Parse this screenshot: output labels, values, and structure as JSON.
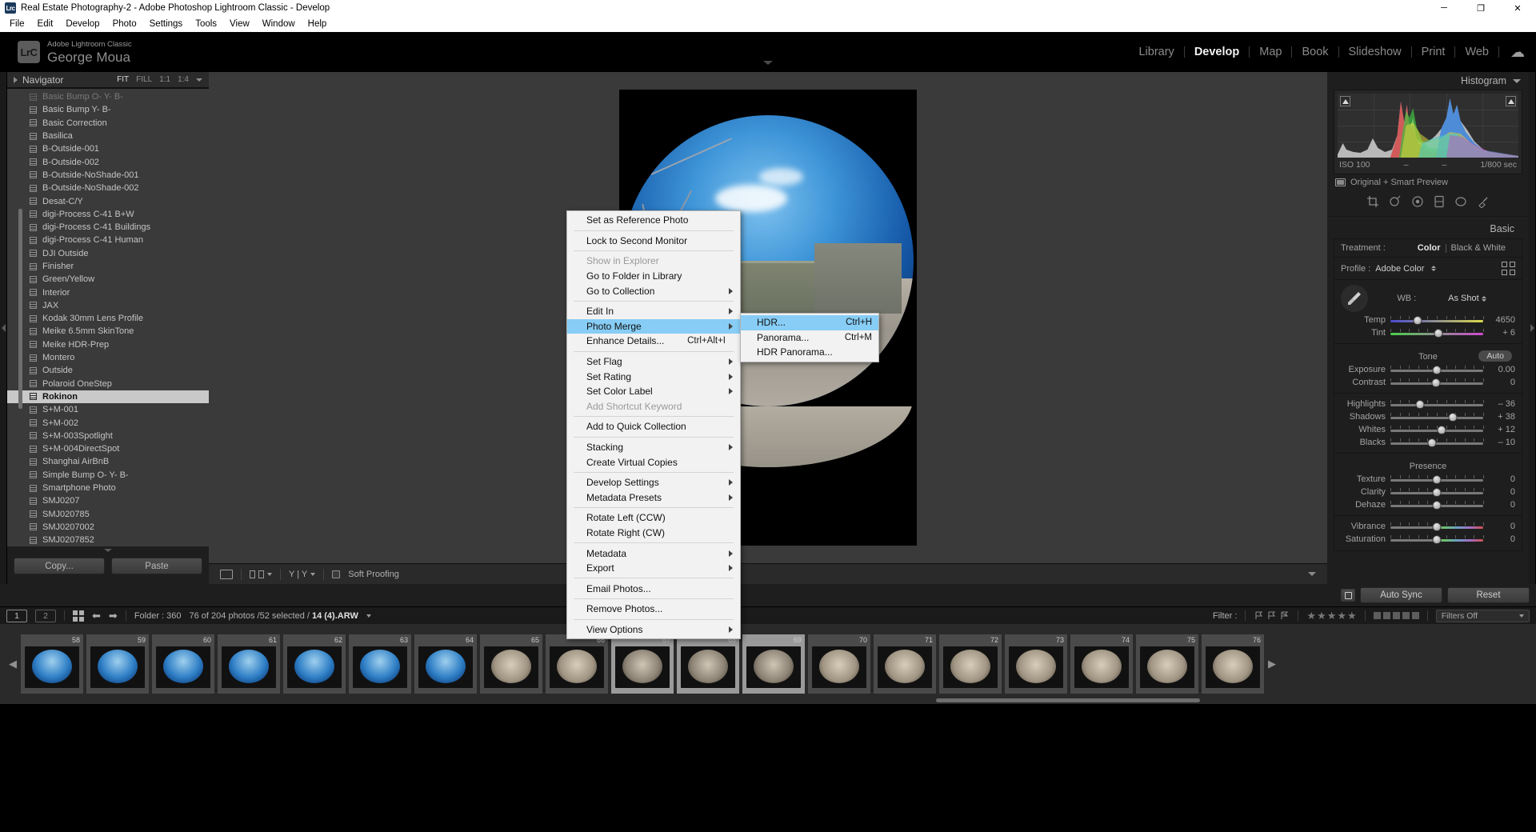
{
  "window": {
    "title": "Real Estate Photography-2 - Adobe Photoshop Lightroom Classic - Develop",
    "app_abbrev": "Lrc",
    "minimize": "─",
    "maximize": "❐",
    "close": "✕"
  },
  "menubar": [
    "File",
    "Edit",
    "Develop",
    "Photo",
    "Settings",
    "Tools",
    "View",
    "Window",
    "Help"
  ],
  "identity": {
    "badge": "LrC",
    "app_name": "Adobe Lightroom Classic",
    "user": "George Moua"
  },
  "modules": [
    {
      "label": "Library",
      "active": false
    },
    {
      "label": "Develop",
      "active": true
    },
    {
      "label": "Map",
      "active": false
    },
    {
      "label": "Book",
      "active": false
    },
    {
      "label": "Slideshow",
      "active": false
    },
    {
      "label": "Print",
      "active": false
    },
    {
      "label": "Web",
      "active": false
    }
  ],
  "navigator": {
    "title": "Navigator",
    "zoom_levels": [
      "FIT",
      "FILL",
      "1:1",
      "1:4"
    ],
    "selected_zoom": "FIT"
  },
  "presets": {
    "items": [
      "Basic Bump O- Y- B-",
      "Basic Bump Y- B-",
      "Basic Correction",
      "Basilica",
      "B-Outside-001",
      "B-Outside-002",
      "B-Outside-NoShade-001",
      "B-Outside-NoShade-002",
      "Desat-C/Y",
      "digi-Process C-41 B+W",
      "digi-Process C-41 Buildings",
      "digi-Process C-41 Human",
      "DJI Outside",
      "Finisher",
      "Green/Yellow",
      "Interior",
      "JAX",
      "Kodak 30mm Lens Profile",
      "Meike 6.5mm SkinTone",
      "Meike HDR-Prep",
      "Montero",
      "Outside",
      "Polaroid OneStep",
      "Rokinon",
      "S+M-001",
      "S+M-002",
      "S+M-003Spotlight",
      "S+M-004DirectSpot",
      "Shanghai AirBnB",
      "Simple Bump O- Y- B-",
      "Smartphone Photo",
      "SMJ0207",
      "SMJ020785",
      "SMJ0207002",
      "SMJ0207852"
    ],
    "selected": "Rokinon",
    "copy_label": "Copy...",
    "paste_label": "Paste"
  },
  "toolbar": {
    "soft_proofing": "Soft Proofing",
    "yy_label": "Y | Y"
  },
  "context_menu": {
    "items": [
      {
        "label": "Set as Reference Photo",
        "type": "item"
      },
      {
        "type": "sep"
      },
      {
        "label": "Lock to Second Monitor",
        "type": "item"
      },
      {
        "type": "sep"
      },
      {
        "label": "Show in Explorer",
        "type": "item",
        "disabled": true
      },
      {
        "label": "Go to Folder in Library",
        "type": "item"
      },
      {
        "label": "Go to Collection",
        "type": "item",
        "submenu": true
      },
      {
        "type": "sep"
      },
      {
        "label": "Edit In",
        "type": "item",
        "submenu": true
      },
      {
        "label": "Photo Merge",
        "type": "item",
        "submenu": true,
        "highlight": true
      },
      {
        "label": "Enhance Details...",
        "type": "item",
        "accel": "Ctrl+Alt+I"
      },
      {
        "type": "sep"
      },
      {
        "label": "Set Flag",
        "type": "item",
        "submenu": true
      },
      {
        "label": "Set Rating",
        "type": "item",
        "submenu": true
      },
      {
        "label": "Set Color Label",
        "type": "item",
        "submenu": true
      },
      {
        "label": "Add Shortcut Keyword",
        "type": "item",
        "disabled": true
      },
      {
        "type": "sep"
      },
      {
        "label": "Add to Quick Collection",
        "type": "item"
      },
      {
        "type": "sep"
      },
      {
        "label": "Stacking",
        "type": "item",
        "submenu": true
      },
      {
        "label": "Create Virtual Copies",
        "type": "item"
      },
      {
        "type": "sep"
      },
      {
        "label": "Develop Settings",
        "type": "item",
        "submenu": true
      },
      {
        "label": "Metadata Presets",
        "type": "item",
        "submenu": true
      },
      {
        "type": "sep"
      },
      {
        "label": "Rotate Left (CCW)",
        "type": "item"
      },
      {
        "label": "Rotate Right (CW)",
        "type": "item"
      },
      {
        "type": "sep"
      },
      {
        "label": "Metadata",
        "type": "item",
        "submenu": true
      },
      {
        "label": "Export",
        "type": "item",
        "submenu": true
      },
      {
        "type": "sep"
      },
      {
        "label": "Email Photos...",
        "type": "item"
      },
      {
        "type": "sep"
      },
      {
        "label": "Remove Photos...",
        "type": "item"
      },
      {
        "type": "sep"
      },
      {
        "label": "View Options",
        "type": "item",
        "submenu": true
      }
    ]
  },
  "submenu": {
    "items": [
      {
        "label": "HDR...",
        "accel": "Ctrl+H",
        "highlight": true
      },
      {
        "label": "Panorama...",
        "accel": "Ctrl+M",
        "highlight": false
      },
      {
        "label": "HDR Panorama...",
        "accel": "",
        "highlight": false
      }
    ]
  },
  "histogram": {
    "title": "Histogram",
    "iso": "ISO 100",
    "focal": "–",
    "aperture": "–",
    "shutter": "1/800 sec",
    "preview_status": "Original + Smart Preview"
  },
  "basic": {
    "title": "Basic",
    "treatment_label": "Treatment :",
    "treatment_color": "Color",
    "treatment_bw": "Black & White",
    "profile_label": "Profile :",
    "profile_value": "Adobe Color",
    "wb_label": "WB :",
    "wb_value": "As Shot",
    "tone_title": "Tone",
    "auto_label": "Auto",
    "presence_title": "Presence",
    "sliders": [
      {
        "name": "Temp",
        "value": "4650",
        "pos": 29,
        "bar": "temp"
      },
      {
        "name": "Tint",
        "value": "+ 6",
        "pos": 52,
        "bar": "tint"
      },
      {
        "name": "Exposure",
        "value": "0.00",
        "pos": 50,
        "bar": "plain"
      },
      {
        "name": "Contrast",
        "value": "0",
        "pos": 49,
        "bar": "plain"
      },
      {
        "name": "Highlights",
        "value": "– 36",
        "pos": 32,
        "bar": "plain"
      },
      {
        "name": "Shadows",
        "value": "+ 38",
        "pos": 67,
        "bar": "plain"
      },
      {
        "name": "Whites",
        "value": "+ 12",
        "pos": 55,
        "bar": "plain"
      },
      {
        "name": "Blacks",
        "value": "– 10",
        "pos": 45,
        "bar": "plain"
      },
      {
        "name": "Texture",
        "value": "0",
        "pos": 50,
        "bar": "plain"
      },
      {
        "name": "Clarity",
        "value": "0",
        "pos": 50,
        "bar": "plain"
      },
      {
        "name": "Dehaze",
        "value": "0",
        "pos": 50,
        "bar": "plain"
      },
      {
        "name": "Vibrance",
        "value": "0",
        "pos": 50,
        "bar": "vib"
      },
      {
        "name": "Saturation",
        "value": "0",
        "pos": 50,
        "bar": "vib"
      }
    ]
  },
  "bottom_controls": {
    "auto_sync": "Auto Sync",
    "reset": "Reset"
  },
  "filmstrip_header": {
    "page1": "1",
    "page2": "2",
    "folder": "Folder : 360",
    "status": "76 of 204 photos /52 selected /",
    "filename": "14 (4).ARW",
    "filter_label": "Filter :",
    "filters_off": "Filters Off"
  },
  "filmstrip": {
    "thumbs": [
      {
        "num": "58",
        "kind": "out",
        "selected": false
      },
      {
        "num": "59",
        "kind": "out",
        "selected": false
      },
      {
        "num": "60",
        "kind": "out",
        "selected": false
      },
      {
        "num": "61",
        "kind": "out",
        "selected": false
      },
      {
        "num": "62",
        "kind": "out",
        "selected": false
      },
      {
        "num": "63",
        "kind": "out",
        "selected": false
      },
      {
        "num": "64",
        "kind": "out",
        "selected": false
      },
      {
        "num": "65",
        "kind": "in",
        "selected": false
      },
      {
        "num": "66",
        "kind": "in",
        "selected": false
      },
      {
        "num": "67",
        "kind": "mix",
        "selected": true
      },
      {
        "num": "68",
        "kind": "mix",
        "selected": true
      },
      {
        "num": "69",
        "kind": "mix",
        "selected": true
      },
      {
        "num": "70",
        "kind": "in",
        "selected": false
      },
      {
        "num": "71",
        "kind": "in",
        "selected": false
      },
      {
        "num": "72",
        "kind": "in",
        "selected": false
      },
      {
        "num": "73",
        "kind": "in",
        "selected": false
      },
      {
        "num": "74",
        "kind": "in",
        "selected": false
      },
      {
        "num": "75",
        "kind": "in",
        "selected": false
      },
      {
        "num": "76",
        "kind": "in",
        "selected": false
      }
    ]
  }
}
